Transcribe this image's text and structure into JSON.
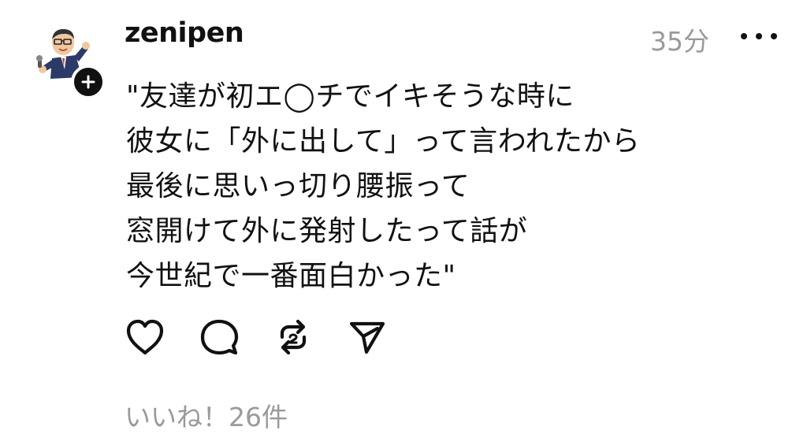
{
  "post": {
    "username": "zenipen",
    "timestamp": "35分",
    "lines": [
      "\"友達が初エ◯チでイキそうな時に",
      "彼女に「外に出して」って言われたから",
      "最後に思いっ切り腰振って",
      "窓開けて外に発射したって話が",
      "今世紀で一番面白かった\""
    ],
    "likes_label": "いいね！26件"
  },
  "icons": {
    "avatar": "avatar-illustration",
    "follow": "plus-icon",
    "more": "more-icon",
    "like": "heart-icon",
    "comment": "comment-icon",
    "repost": "repost-icon",
    "share": "send-icon"
  },
  "colors": {
    "text": "#111111",
    "muted": "#9a9a9a",
    "background": "#ffffff"
  }
}
